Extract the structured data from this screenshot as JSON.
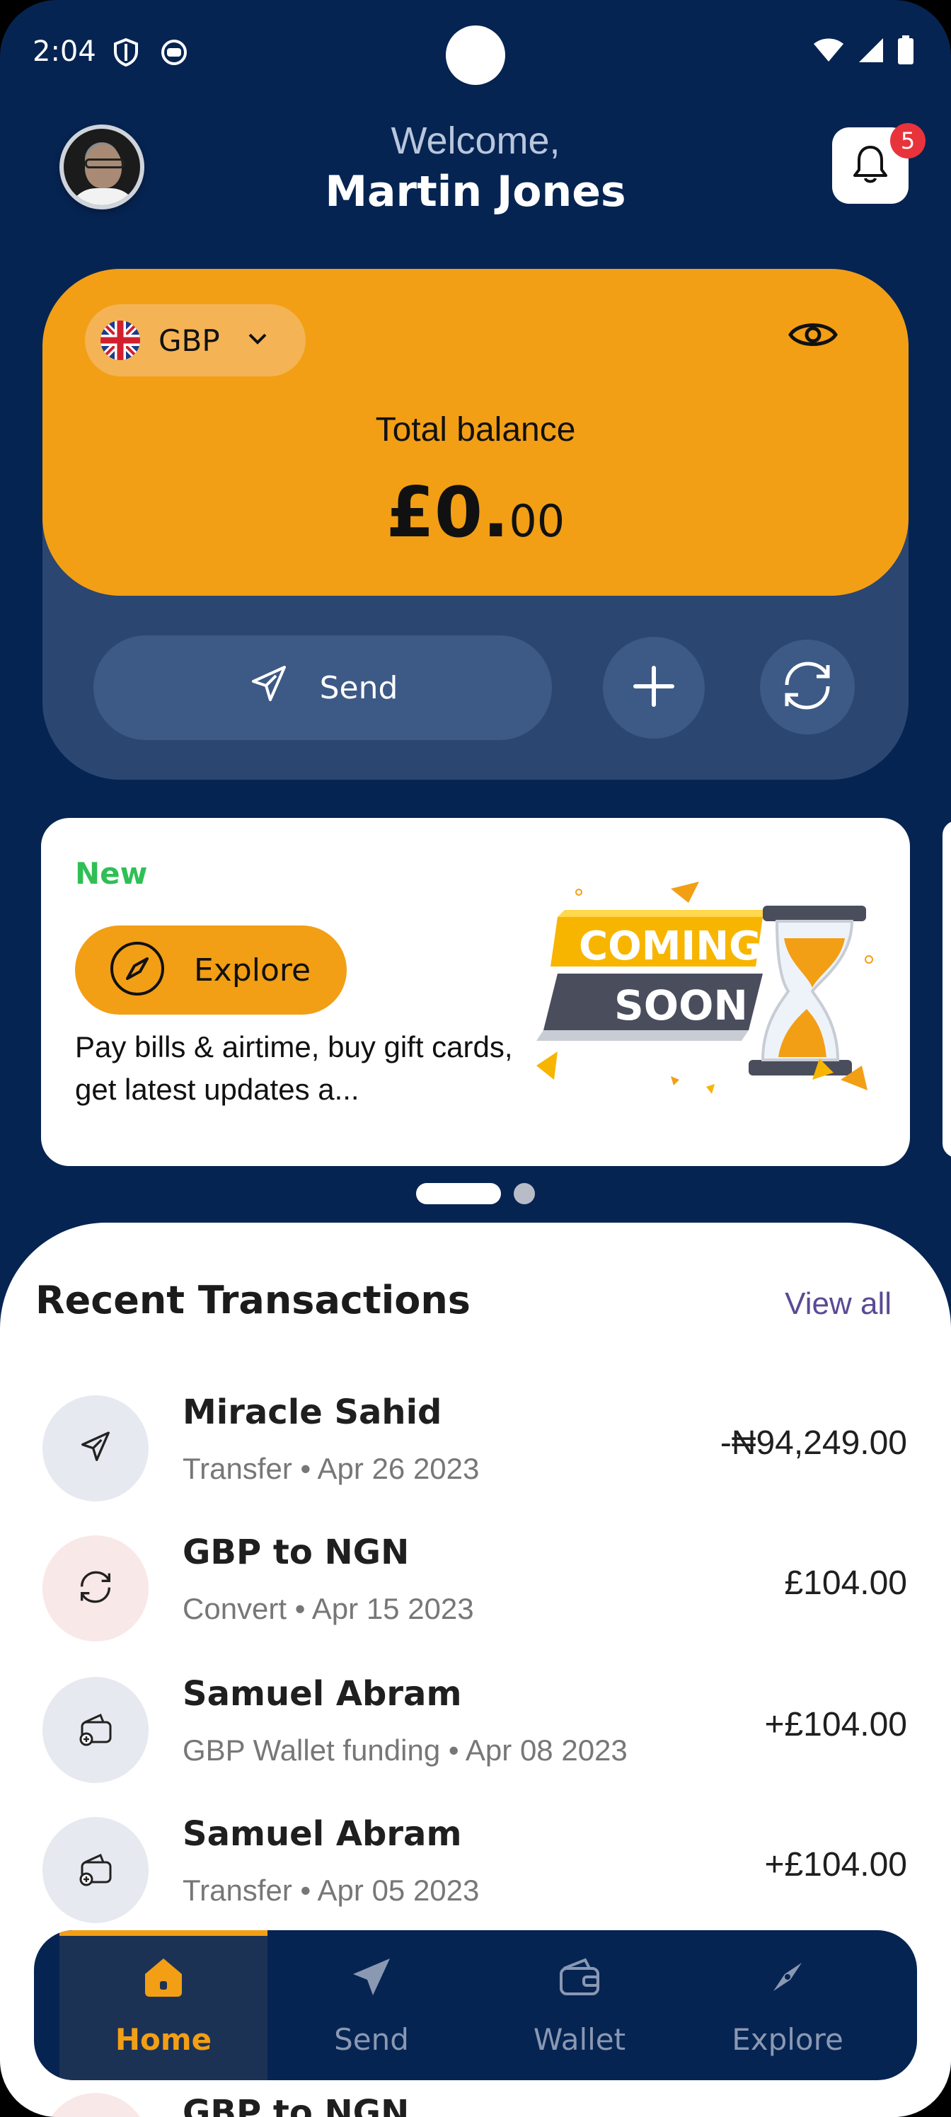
{
  "status_bar": {
    "time": "2:04"
  },
  "header": {
    "welcome": "Welcome,",
    "user_name": "Martin Jones",
    "notification_count": "5"
  },
  "balance_card": {
    "currency": "GBP",
    "total_label": "Total balance",
    "amount_main": "£0.",
    "amount_decimal": "00",
    "accent_color": "#f29f15"
  },
  "actions": {
    "send_label": "Send"
  },
  "promo": {
    "tag": "New",
    "button_label": "Explore",
    "description": "Pay bills & airtime, buy gift cards, get latest updates a...",
    "image_line1": "COMING",
    "image_line2": "SOON",
    "page_count": 2,
    "active_page": 1
  },
  "transactions": {
    "title": "Recent Transactions",
    "view_all": "View all",
    "items": [
      {
        "name": "Miracle Sahid",
        "meta": "Transfer • Apr 26 2023",
        "amount": "-₦94,249.00",
        "icon": "send-icon"
      },
      {
        "name": "GBP to NGN",
        "meta": "Convert • Apr 15 2023",
        "amount": "£104.00",
        "icon": "convert-icon"
      },
      {
        "name": "Samuel Abram",
        "meta": "GBP Wallet funding • Apr 08 2023",
        "amount": "+£104.00",
        "icon": "wallet-add-icon"
      },
      {
        "name": "Samuel Abram",
        "meta": "Transfer • Apr 05 2023",
        "amount": "+£104.00",
        "icon": "wallet-add-icon"
      },
      {
        "name": "GBP to NGN",
        "meta": "",
        "amount": "",
        "icon": "convert-icon"
      }
    ]
  },
  "nav": {
    "items": [
      {
        "label": "Home",
        "icon": "home-icon",
        "active": true
      },
      {
        "label": "Send",
        "icon": "send-icon",
        "active": false
      },
      {
        "label": "Wallet",
        "icon": "wallet-icon",
        "active": false
      },
      {
        "label": "Explore",
        "icon": "compass-icon",
        "active": false
      }
    ]
  }
}
